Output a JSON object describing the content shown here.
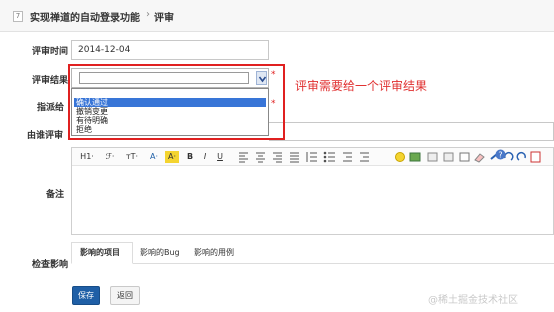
{
  "header": {
    "badge": "7",
    "title": "实现禅道的自动登录功能",
    "separator": "›",
    "subtitle": "评审"
  },
  "form": {
    "review_date": {
      "label": "评审时间",
      "value": "2014-12-04"
    },
    "review_result": {
      "label": "评审结果",
      "value": "",
      "required_mark": "*",
      "options": [
        "",
        "确认通过",
        "撤销变更",
        "有待明确",
        "拒绝"
      ],
      "highlighted_option": "确认通过"
    },
    "assigned_to": {
      "label": "指派给",
      "required_mark": "*"
    },
    "reviewed_by": {
      "label": "由谁评审"
    },
    "comment": {
      "label": "备注"
    },
    "impact": {
      "label": "检查影响",
      "tabs": [
        "影响的项目",
        "影响的Bug",
        "影响的用例"
      ],
      "active_tab": "影响的项目"
    }
  },
  "annotation": "评审需要给一个评审结果",
  "toolbar": {
    "heading": "H1·",
    "font": "ℱ·",
    "size": "тT·",
    "font_color": "A·",
    "bg_color": "A·",
    "bold": "B",
    "italic": "I",
    "underline": "U"
  },
  "buttons": {
    "save": "保存",
    "back": "返回"
  },
  "watermark": "@稀土掘金技术社区",
  "colors": {
    "primary": "#1f5fa6",
    "annotation": "#e02020",
    "dropdown_highlight": "#3875d7"
  }
}
